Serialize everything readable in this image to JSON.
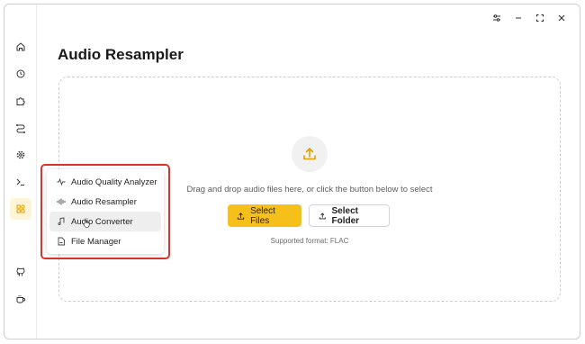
{
  "window": {
    "controls": [
      {
        "name": "settings",
        "icon": "sliders-icon"
      },
      {
        "name": "minimize",
        "icon": "minimize-icon"
      },
      {
        "name": "maximize",
        "icon": "maximize-icon"
      },
      {
        "name": "close",
        "icon": "close-icon"
      }
    ]
  },
  "sidebar": {
    "items": [
      {
        "id": "home",
        "icon": "home-icon"
      },
      {
        "id": "history",
        "icon": "history-icon"
      },
      {
        "id": "extensions",
        "icon": "puzzle-icon"
      },
      {
        "id": "workflow",
        "icon": "workflow-icon"
      },
      {
        "id": "settings",
        "icon": "gear-icon"
      },
      {
        "id": "terminal",
        "icon": "terminal-icon"
      },
      {
        "id": "tools",
        "icon": "apps-icon",
        "active": true
      },
      {
        "id": "github",
        "icon": "github-icon"
      },
      {
        "id": "coffee",
        "icon": "coffee-icon"
      }
    ]
  },
  "main": {
    "title": "Audio Resampler",
    "dropzone": {
      "instruction": "Drag and drop audio files here, or click the button below to select",
      "select_files_label": "Select Files",
      "select_folder_label": "Select Folder",
      "supported_formats": "Supported format: FLAC"
    }
  },
  "tools_menu": {
    "items": [
      {
        "label": "Audio Quality Analyzer",
        "icon": "waveform-icon"
      },
      {
        "label": "Audio Resampler",
        "icon": "audio-wave-icon"
      },
      {
        "label": "Audio Converter",
        "icon": "music-note-icon",
        "hovered": true
      },
      {
        "label": "File Manager",
        "icon": "file-icon"
      }
    ]
  },
  "colors": {
    "accent": "#f6bf1a",
    "highlight": "#d9342b",
    "active_bg": "#fff4d6"
  }
}
